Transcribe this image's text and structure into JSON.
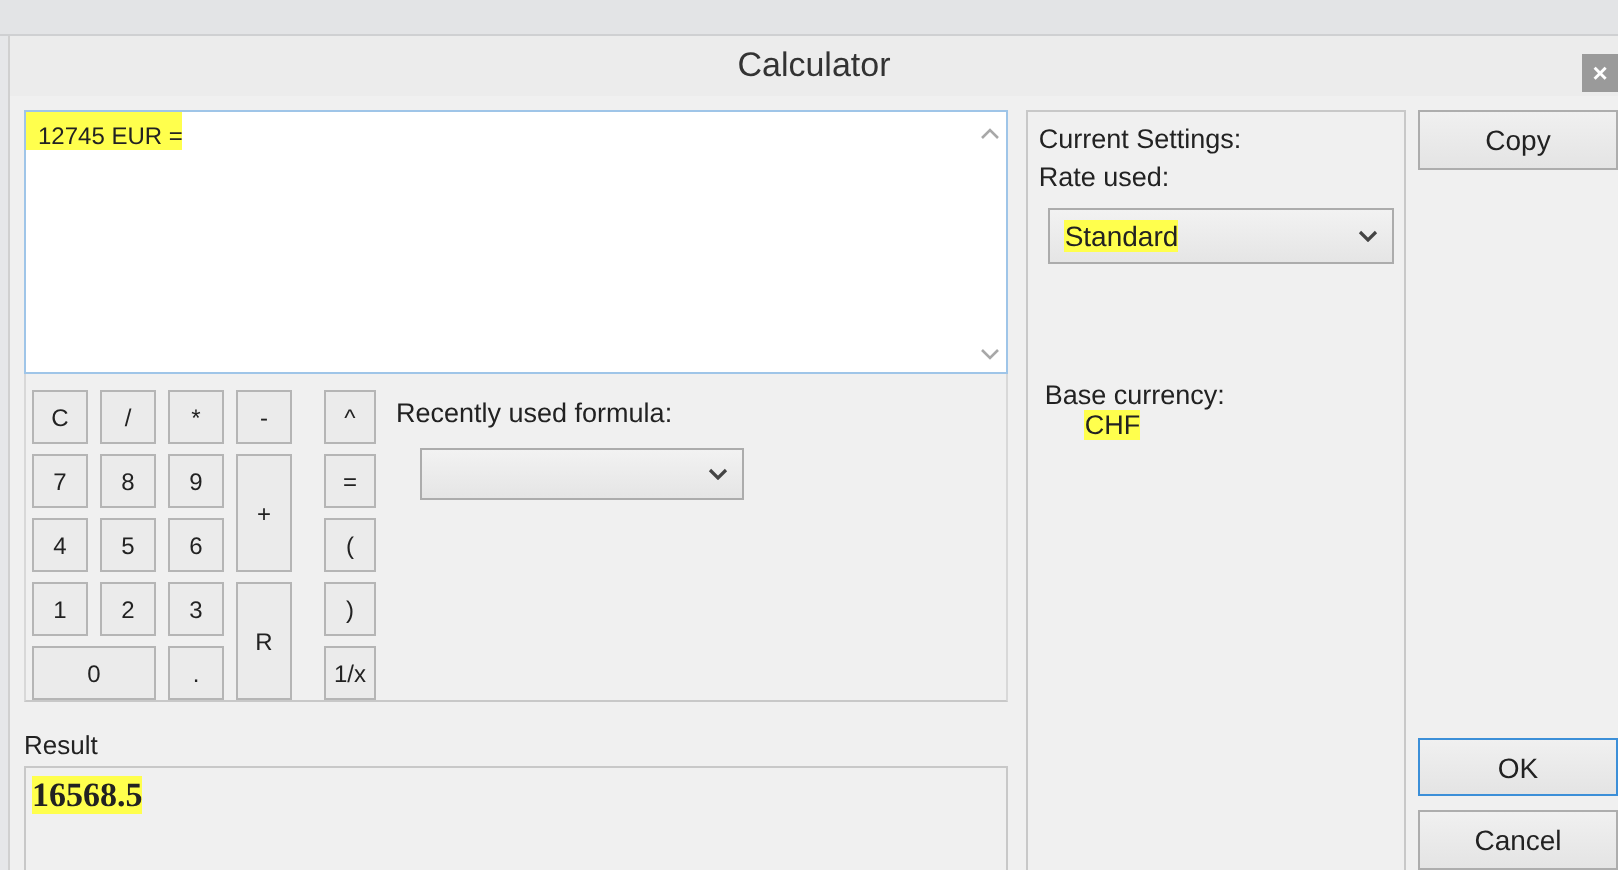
{
  "window": {
    "title": "Calculator",
    "close": "×"
  },
  "formula": {
    "value": "12745 EUR =",
    "highlighted": true
  },
  "keypad": [
    {
      "label": "C"
    },
    {
      "label": "/"
    },
    {
      "label": "*"
    },
    {
      "label": "-"
    },
    {
      "label": "7"
    },
    {
      "label": "8"
    },
    {
      "label": "9"
    },
    {
      "label": "+"
    },
    {
      "label": "4"
    },
    {
      "label": "5"
    },
    {
      "label": "6"
    },
    {
      "label": "1"
    },
    {
      "label": "2"
    },
    {
      "label": "3"
    },
    {
      "label": "R"
    },
    {
      "label": "0"
    },
    {
      "label": "."
    }
  ],
  "operators": [
    {
      "label": "^"
    },
    {
      "label": "="
    },
    {
      "label": "("
    },
    {
      "label": ")"
    },
    {
      "label": "1/x"
    }
  ],
  "recent": {
    "label": "Recently used formula:"
  },
  "result": {
    "label": "Result",
    "value": "16568.5",
    "highlighted": true
  },
  "settings": {
    "heading": "Current Settings:",
    "rate_label": "Rate used:",
    "rate": "Standard",
    "rate_highlighted": true,
    "base_label": "Base currency:",
    "base": "CHF",
    "base_highlighted": true
  },
  "buttons": [
    {
      "label": "Copy",
      "kind": "top",
      "default": false
    },
    {
      "label": "OK",
      "kind": "bottom",
      "default": true
    },
    {
      "label": "Cancel",
      "kind": "bottom",
      "default": false
    }
  ]
}
